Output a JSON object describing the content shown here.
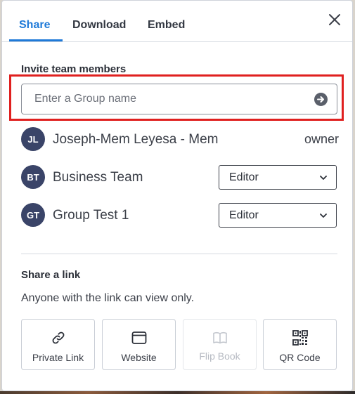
{
  "tabs": [
    {
      "label": "Share",
      "active": true
    },
    {
      "label": "Download",
      "active": false
    },
    {
      "label": "Embed",
      "active": false
    }
  ],
  "close_icon": "close-icon",
  "invite": {
    "title": "Invite team members",
    "placeholder": "Enter a Group name",
    "value": ""
  },
  "members": [
    {
      "initials": "JL",
      "name": "Joseph-Mem Leyesa - Mem",
      "role": "owner"
    },
    {
      "initials": "BT",
      "name": "Business Team",
      "role": "Editor"
    },
    {
      "initials": "GT",
      "name": "Group Test 1",
      "role": "Editor"
    }
  ],
  "share_link": {
    "title": "Share a link",
    "description": "Anyone with the link can view only.",
    "options": [
      {
        "label": "Private Link",
        "icon": "link-icon",
        "enabled": true
      },
      {
        "label": "Website",
        "icon": "browser-window-icon",
        "enabled": true
      },
      {
        "label": "Flip Book",
        "icon": "open-book-icon",
        "enabled": false
      },
      {
        "label": "QR Code",
        "icon": "qr-code-icon",
        "enabled": true
      }
    ]
  },
  "colors": {
    "accent": "#1f7ad8",
    "avatar": "#3a4468",
    "highlight": "#e0201f"
  }
}
